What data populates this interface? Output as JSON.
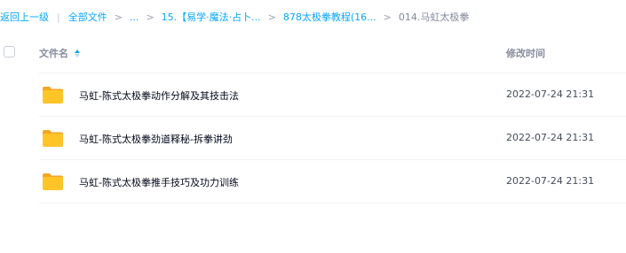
{
  "breadcrumb": {
    "back": "返回上一级",
    "all_files": "全部文件",
    "ellipsis": "...",
    "crumb1": "15.【易学·魔法·占卜...",
    "crumb2": "878太极拳教程(16...",
    "current": "014.马虹太极拳"
  },
  "header": {
    "name_label": "文件名",
    "time_label": "修改时间"
  },
  "files": [
    {
      "name": "马虹-陈式太极拳动作分解及其技击法",
      "modified": "2022-07-24 21:31",
      "icon": "folder-icon"
    },
    {
      "name": "马虹-陈式太极拳劲道释秘-拆拳讲劲",
      "modified": "2022-07-24 21:31",
      "icon": "folder-icon"
    },
    {
      "name": "马虹-陈式太极拳推手技巧及功力训练",
      "modified": "2022-07-24 21:31",
      "icon": "folder-icon"
    }
  ],
  "colors": {
    "link": "#06a7ff",
    "folder": "#ffc528",
    "folder_dark": "#f5a623"
  }
}
